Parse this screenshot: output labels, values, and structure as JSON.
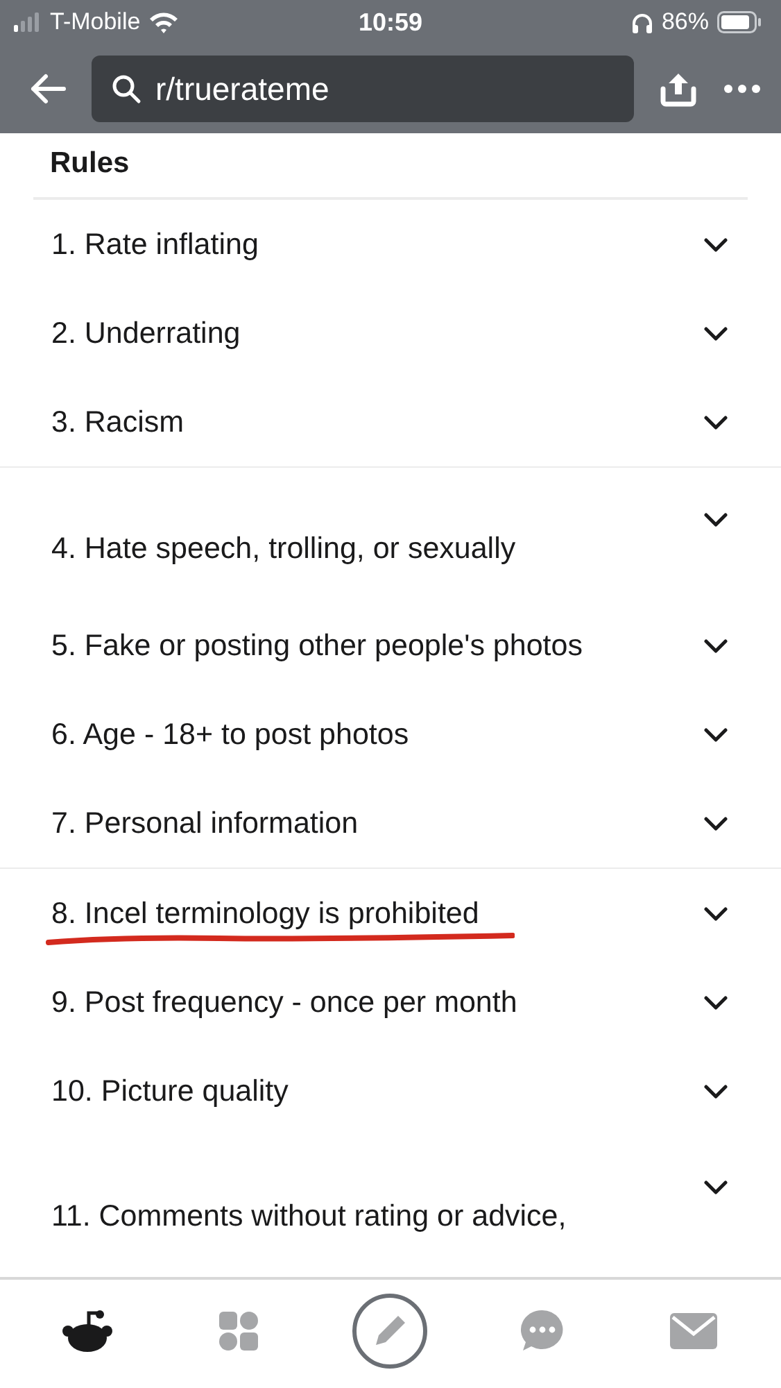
{
  "status_bar": {
    "carrier": "T-Mobile",
    "time": "10:59",
    "battery": "86%"
  },
  "header": {
    "search": {
      "value": "r/truerateme"
    }
  },
  "section_title": "Rules",
  "rule_groups": [
    {
      "rules": [
        {
          "text": "1. Rate inflating",
          "kind": "single",
          "underlined": false
        },
        {
          "text": "2. Underrating",
          "kind": "single",
          "underlined": false
        },
        {
          "text": "3. Racism",
          "kind": "single",
          "underlined": false
        }
      ]
    },
    {
      "rules": [
        {
          "text": "4. Hate speech, trolling, or sexually",
          "kind": "wrapped",
          "underlined": false
        },
        {
          "text": "5. Fake or posting other people's photos",
          "kind": "single",
          "underlined": false
        },
        {
          "text": "6. Age - 18+ to post photos",
          "kind": "single",
          "underlined": false
        },
        {
          "text": "7. Personal information",
          "kind": "single",
          "underlined": false
        }
      ]
    },
    {
      "rules": [
        {
          "text": "8. Incel terminology is prohibited",
          "kind": "single",
          "underlined": true
        },
        {
          "text": "9. Post frequency - once per month",
          "kind": "single",
          "underlined": false
        },
        {
          "text": "10. Picture quality",
          "kind": "single",
          "underlined": false
        },
        {
          "text": "11. Comments without rating or advice,",
          "kind": "wrapped",
          "underlined": false
        }
      ]
    }
  ],
  "tab_bar": [
    {
      "kind": "home",
      "selected": true
    },
    {
      "kind": "communities",
      "selected": false
    },
    {
      "kind": "post",
      "selected": false
    },
    {
      "kind": "chat",
      "selected": false
    },
    {
      "kind": "inbox",
      "selected": false
    }
  ]
}
